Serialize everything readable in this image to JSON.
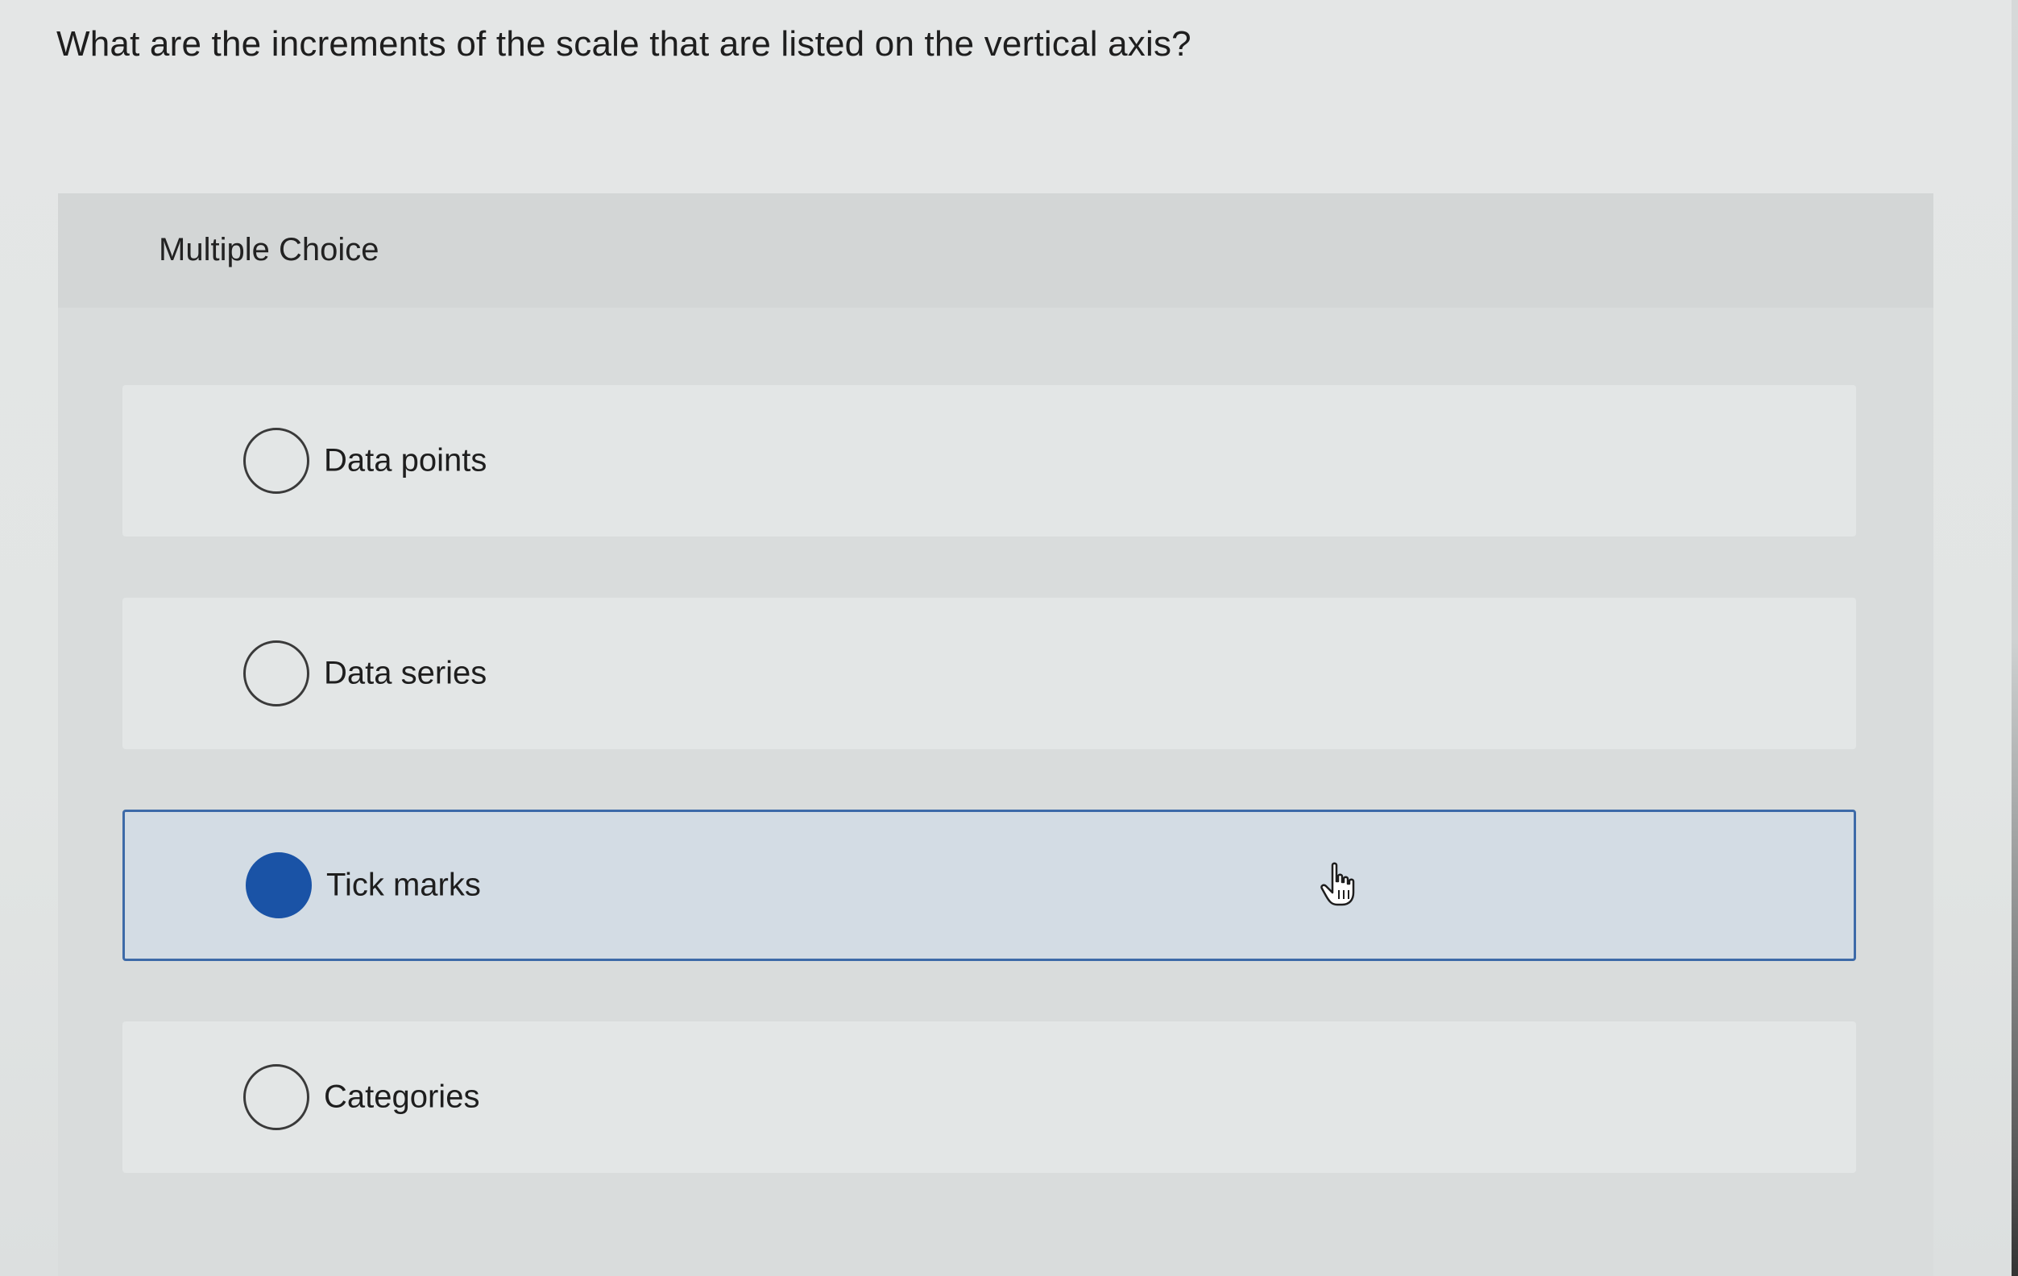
{
  "question": {
    "text": "What are the increments of the scale that are listed on the vertical axis?"
  },
  "panel": {
    "title": "Multiple Choice"
  },
  "options": [
    {
      "label": "Data points",
      "selected": false
    },
    {
      "label": "Data series",
      "selected": false
    },
    {
      "label": "Tick marks",
      "selected": true
    },
    {
      "label": "Categories",
      "selected": false
    }
  ],
  "colors": {
    "selected_fill": "#1a53a6",
    "selected_border": "#3d6aa8",
    "selected_background": "#d3dce4"
  },
  "icons": {
    "cursor": "hand-pointer-icon"
  }
}
